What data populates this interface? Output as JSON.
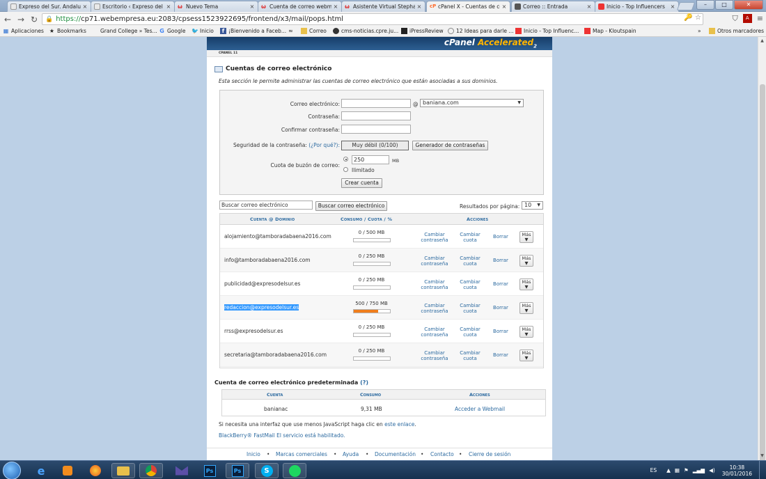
{
  "browser": {
    "tabs": [
      {
        "title": "Expreso del Sur. Andaluc",
        "favicon_color": "#e9e9e9"
      },
      {
        "title": "Escritorio ‹ Expreso del S",
        "favicon_color": "#e9e9e9"
      },
      {
        "title": "Nuevo Tema",
        "favicon_color": "#d33"
      },
      {
        "title": "Cuenta de correo webm",
        "favicon_color": "#d33"
      },
      {
        "title": "Asistente Virtual Stephan",
        "favicon_color": "#d33"
      },
      {
        "title": "cPanel X - Cuentas de co",
        "favicon_color": "#ff6c2c"
      },
      {
        "title": "Correo :: Entrada",
        "favicon_color": "#555"
      },
      {
        "title": "Inicio - Top Influencers",
        "favicon_color": "#e33"
      }
    ],
    "url_scheme": "https://",
    "url_rest": "cp71.webempresa.eu:2083/cpsess1523922695/frontend/x3/mail/pops.html",
    "bookmarks": [
      {
        "label": "Aplicaciones",
        "icon": "apps-grid-icon"
      },
      {
        "label": "Bookmarks",
        "icon": "star-icon"
      },
      {
        "label": "Grand College » Tes...",
        "icon": "page-icon"
      },
      {
        "label": "Google",
        "icon": "google-icon"
      },
      {
        "label": "Inicio",
        "icon": "twitter-icon"
      },
      {
        "label": "¡Bienvenido a Faceb...",
        "icon": "facebook-icon"
      },
      {
        "label": "",
        "icon": "rss-icon"
      },
      {
        "label": "Correo",
        "icon": "folder-icon"
      },
      {
        "label": "cms-noticias.cpre.ju...",
        "icon": "globe-icon"
      },
      {
        "label": "iPressReview",
        "icon": "ipress-icon"
      },
      {
        "label": "12 Ideas para darle ...",
        "icon": "idea-icon"
      },
      {
        "label": "Inicio - Top Influenc...",
        "icon": "klout-icon"
      },
      {
        "label": "Map - Kloutspain",
        "icon": "klout-icon"
      }
    ],
    "bookmarks_more": "»",
    "other_bookmarks": "Otros marcadores"
  },
  "cpanel": {
    "brand_main": "cPanel",
    "brand_accent": "Accelerated",
    "brand_num": "2",
    "version": "CPANEL 11",
    "section_title": "Cuentas de correo electrónico",
    "section_desc": "Esta sección le permite administrar las cuentas de correo electrónico que están asociadas a sus dominios.",
    "form": {
      "email_label": "Correo electrónico:",
      "at": "@",
      "domain": "baniana.com",
      "password_label": "Contraseña:",
      "confirm_label": "Confirmar contraseña:",
      "strength_label": "Seguridad de la contraseña:",
      "strength_why": "(¿Por qué?):",
      "strength_value": "Muy débil (0/100)",
      "generator_btn": "Generador de contraseñas",
      "quota_label": "Cuota de buzón de correo:",
      "quota_value": "250",
      "quota_unit": "MB",
      "unlimited_label": "Ilimitado",
      "create_btn": "Crear cuenta"
    },
    "search": {
      "placeholder": "Buscar correo electrónico",
      "button": "Buscar correo electrónico",
      "results_label": "Resultados por página:",
      "results_value": "10"
    },
    "table_headers": {
      "account": "Cuenta @ Dominio",
      "usage": "Consumo / Cuota / %",
      "actions": "Acciones"
    },
    "accounts": [
      {
        "email": "alojamiento@tamboradabaena2016.com",
        "usage": "0 / 500 MB",
        "percent": 0
      },
      {
        "email": "info@tamboradabaena2016.com",
        "usage": "0 / 250 MB",
        "percent": 0
      },
      {
        "email": "publicidad@expresodelsur.es",
        "usage": "0 / 250 MB",
        "percent": 0
      },
      {
        "email": "redaccion@expresodelsur.es",
        "usage": "500 / 750 MB",
        "percent": 66.7
      },
      {
        "email": "rrss@expresodelsur.es",
        "usage": "0 / 250 MB",
        "percent": 0
      },
      {
        "email": "secretaria@tamboradabaena2016.com",
        "usage": "0 / 250 MB",
        "percent": 0
      }
    ],
    "actions": {
      "change_password_1": "Cambiar",
      "change_password_2": "contraseña",
      "change_quota_1": "Cambiar",
      "change_quota_2": "cuota",
      "delete": "Borrar",
      "more": "Más"
    },
    "default_account": {
      "title": "Cuenta de correo electrónico predeterminada",
      "help": "(?)",
      "headers": {
        "account": "Cuenta",
        "usage": "Consumo",
        "actions": "Acciones"
      },
      "account": "banianac",
      "usage": "9,31 MB",
      "action": "Acceder a Webmail"
    },
    "note_js_prefix": "Si necesita una interfaz que use menos JavaScript haga clic en",
    "note_js_link": "este enlace",
    "note_js_suffix": ".",
    "note_bb": "BlackBerry® FastMail El servicio está habilitado.",
    "footer": [
      "Inicio",
      "Marcas comerciales",
      "Ayuda",
      "Documentación",
      "Contacto",
      "Cierre de sesión"
    ]
  },
  "taskbar": {
    "lang": "ES",
    "time": "10:38",
    "date": "30/01/2016",
    "apps": [
      "internet-explorer",
      "media-player",
      "firefox",
      "file-explorer",
      "chrome",
      "outlook",
      "photoshop",
      "photoshop",
      "skype",
      "spotify"
    ]
  }
}
